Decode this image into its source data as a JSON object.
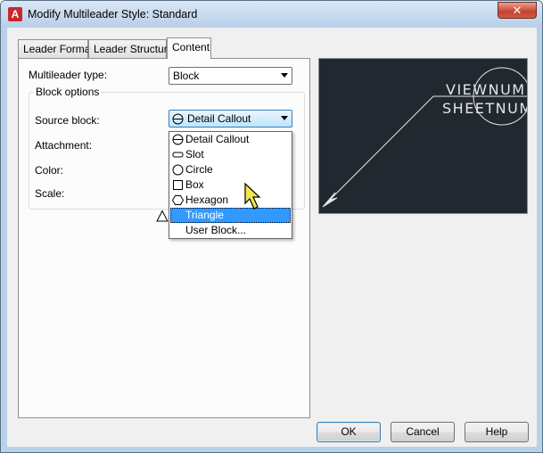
{
  "window": {
    "title": "Modify Multileader Style: Standard",
    "icon": "autocad-a-icon",
    "close_glyph": "✕",
    "app_icon_letter": "A"
  },
  "tabs": [
    {
      "label": "Leader Format",
      "active": false
    },
    {
      "label": "Leader Structure",
      "active": false
    },
    {
      "label": "Content",
      "active": true
    }
  ],
  "content": {
    "multileader_type_label": "Multileader type:",
    "multileader_type_value": "Block",
    "block_options_legend": "Block options",
    "source_block_label": "Source block:",
    "source_block_value": "Detail Callout",
    "attachment_label": "Attachment:",
    "color_label": "Color:",
    "scale_label": "Scale:"
  },
  "dropdown": {
    "items": [
      {
        "label": "Detail Callout",
        "icon": "detail-callout-icon"
      },
      {
        "label": "Slot",
        "icon": "slot-icon"
      },
      {
        "label": "Circle",
        "icon": "circle-icon"
      },
      {
        "label": "Box",
        "icon": "box-icon"
      },
      {
        "label": "Hexagon",
        "icon": "hexagon-icon"
      },
      {
        "label": "Triangle",
        "icon": "triangle-icon",
        "selected": true
      },
      {
        "label": "User Block...",
        "icon": ""
      }
    ]
  },
  "preview": {
    "line1": "VIEWNUMBER",
    "line2": "SHEETNUMBER"
  },
  "buttons": {
    "ok": "OK",
    "cancel": "Cancel",
    "help": "Help"
  },
  "colors": {
    "selection": "#3399ff",
    "preview_bg": "#212830",
    "close_red": "#c7412f"
  }
}
